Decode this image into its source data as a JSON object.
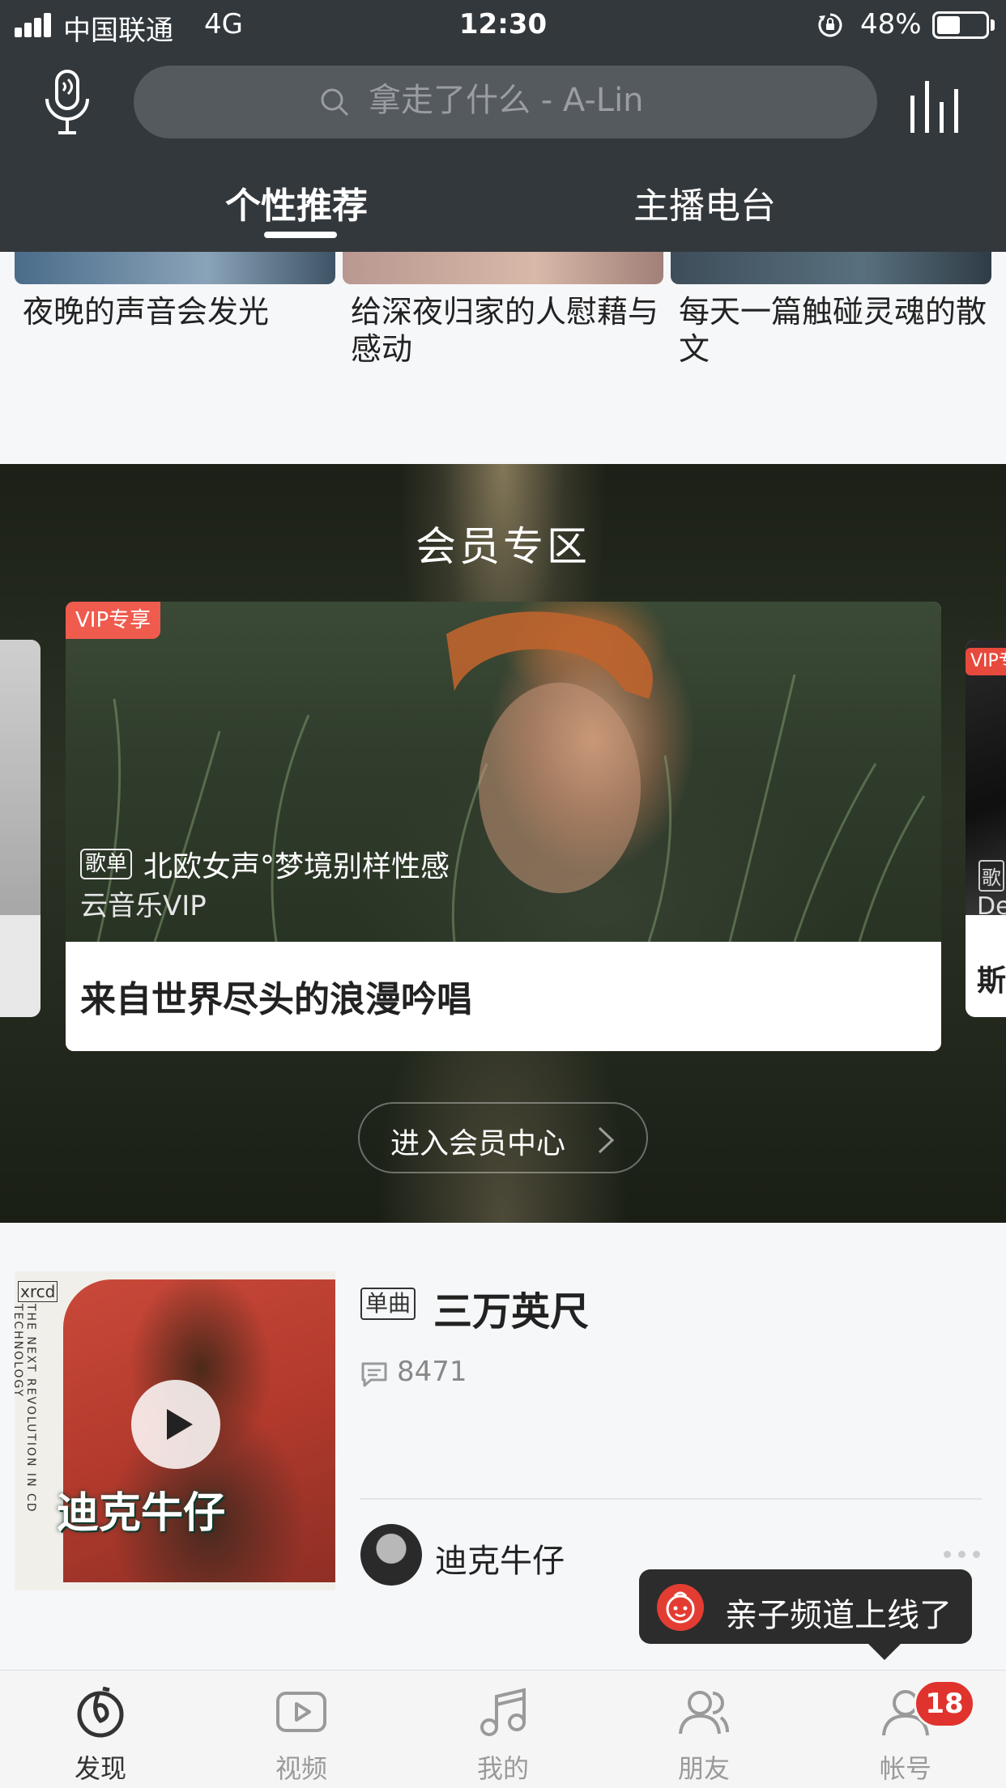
{
  "status_bar": {
    "carrier": "中国联通",
    "network": "4G",
    "time": "12:30",
    "battery_percent": "48%",
    "battery_level": 0.48
  },
  "header": {
    "search_placeholder": "拿走了什么 - A-Lin",
    "tabs": [
      {
        "label": "个性推荐",
        "active": true
      },
      {
        "label": "主播电台",
        "active": false
      }
    ]
  },
  "top_cards": [
    {
      "caption": "夜晚的声音会发光"
    },
    {
      "caption": "给深夜归家的人慰藉与感动"
    },
    {
      "caption": "每天一篇触碰灵魂的散文"
    }
  ],
  "vip_section": {
    "title": "会员专区",
    "main_card": {
      "badge": "VIP专享",
      "tag": "歌单",
      "list_title": "北欧女声°梦境别样性感",
      "subtitle": "云音乐VIP",
      "title": "来自世界尽头的浪漫吟唱"
    },
    "right_card": {
      "badge": "VIP专",
      "tag": "歌",
      "subtitle": "De",
      "title": "斯"
    },
    "enter_button": "进入会员中心"
  },
  "song_card": {
    "cover_text": "迪克牛仔",
    "cover_brand": "xrcd",
    "cover_side_text": "THE NEXT REVOLUTION IN CD TECHNOLOGY",
    "tag": "单曲",
    "title": "三万英尺",
    "comment_count": "8471",
    "artist": "迪克牛仔"
  },
  "toast": {
    "text": "亲子频道上线了"
  },
  "tab_bar": {
    "items": [
      {
        "label": "发现",
        "icon": "discover-icon",
        "active": true
      },
      {
        "label": "视频",
        "icon": "video-icon",
        "active": false
      },
      {
        "label": "我的",
        "icon": "music-note-icon",
        "active": false
      },
      {
        "label": "朋友",
        "icon": "friends-icon",
        "active": false
      },
      {
        "label": "帐号",
        "icon": "account-icon",
        "active": false
      }
    ],
    "account_badge": "18"
  },
  "colors": {
    "header_bg": "#33383c",
    "vip_badge": "#ef5b4d",
    "notification_badge": "#e0332d"
  }
}
